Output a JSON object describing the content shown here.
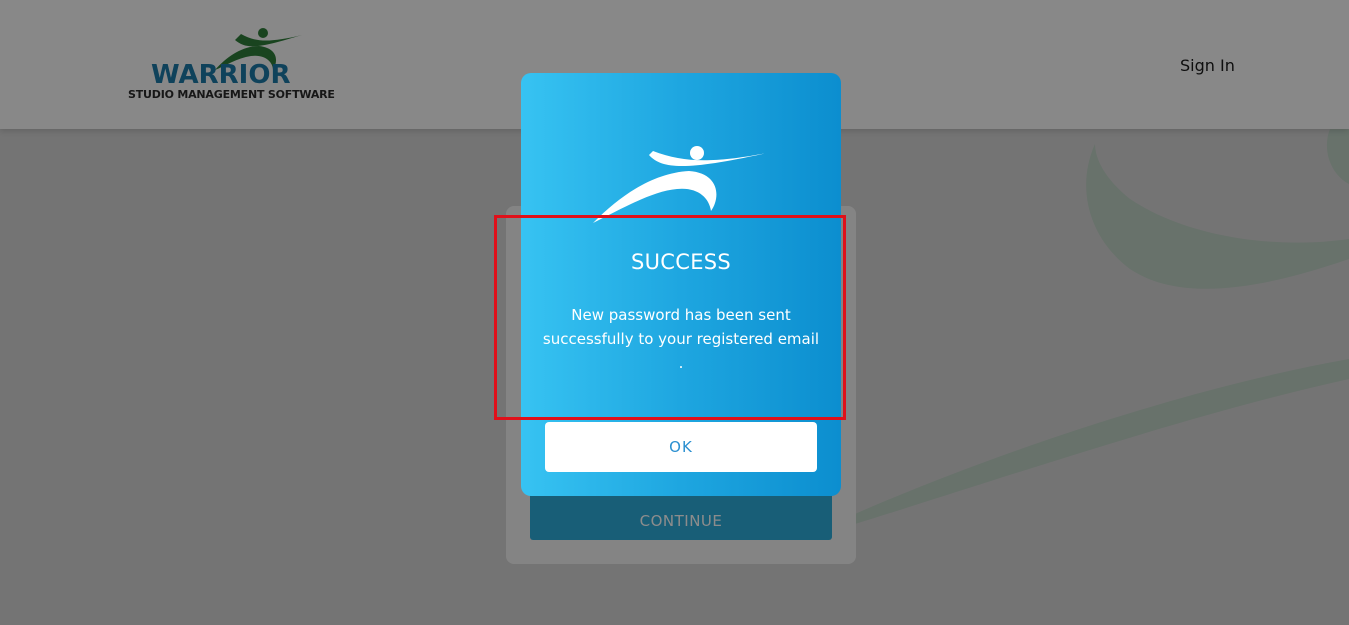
{
  "header": {
    "logo": {
      "word": "WARRIOR",
      "tagline": "STUDIO MANAGEMENT SOFTWARE"
    },
    "sign_in_label": "Sign In"
  },
  "login_card": {
    "continue_label": "CONTINUE"
  },
  "dialog": {
    "title": "SUCCESS",
    "message": "New password has been sent successfully to your registered email .",
    "ok_label": "OK"
  },
  "colors": {
    "dialog_gradient_start": "#37c3f2",
    "dialog_gradient_end": "#0c8ecf",
    "continue_button": "#2dabd9",
    "logo_blue": "#1d79a6",
    "logo_green": "#2e7d3a",
    "highlight": "#e0101a"
  },
  "icons": {
    "logo_figure": "warrior-figure-icon",
    "dialog_figure": "warrior-figure-icon"
  }
}
